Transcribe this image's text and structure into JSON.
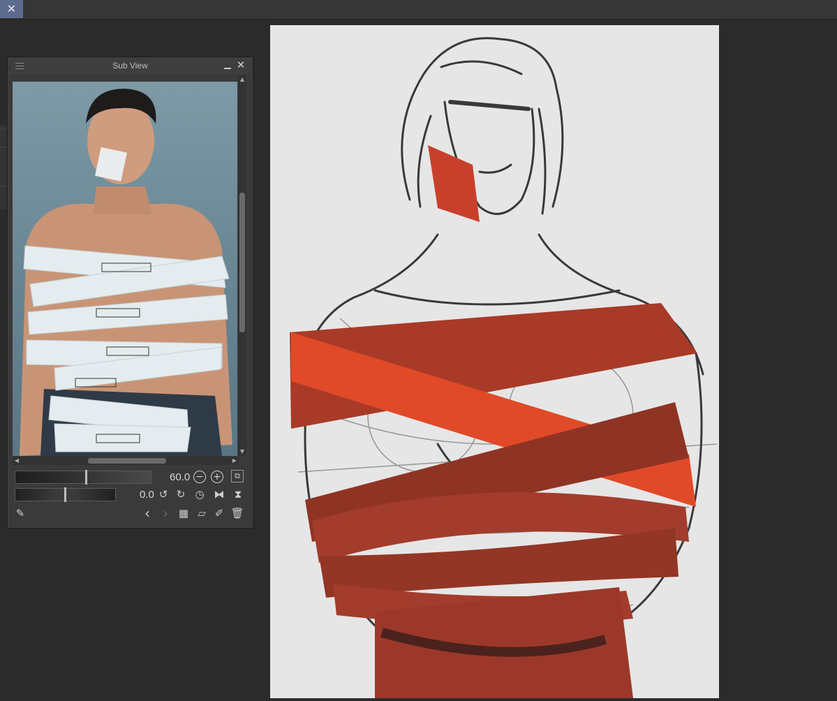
{
  "window": {
    "close_icon": "close-icon",
    "accent": "#5d6b8f"
  },
  "subview": {
    "title": "Sub View",
    "zoom_value": "60.0",
    "rotation_value": "0.0",
    "zoom_level": 0.52,
    "rotation_level": 0.5
  },
  "canvas": {
    "background": "#e6e6e6",
    "tape_colors": [
      "#a33c2c",
      "#e04a2a"
    ]
  }
}
